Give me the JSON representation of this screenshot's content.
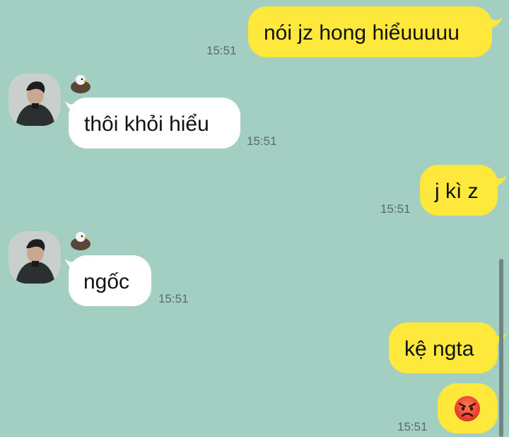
{
  "messages": [
    {
      "dir": "out",
      "text": "nói jz hong hiểuuuuu",
      "time": "15:51"
    },
    {
      "dir": "in",
      "text": "thôi khỏi hiểu",
      "time": "15:51"
    },
    {
      "dir": "out",
      "text": "j kì z",
      "time": "15:51"
    },
    {
      "dir": "in",
      "text": "ngốc",
      "time": "15:51"
    },
    {
      "dir": "out",
      "text": "kệ ngta",
      "time": ""
    },
    {
      "dir": "out",
      "emoji": "angry-face",
      "time": "15:51"
    }
  ],
  "colors": {
    "background": "#a3cfc2",
    "outgoing_bubble": "#fde83b",
    "incoming_bubble": "#ffffff",
    "timestamp": "#5a6a66"
  },
  "icons": {
    "avatar": "contact-avatar-photo",
    "badge": "eagle-badge-icon",
    "emoji": "angry-face-emoji"
  }
}
